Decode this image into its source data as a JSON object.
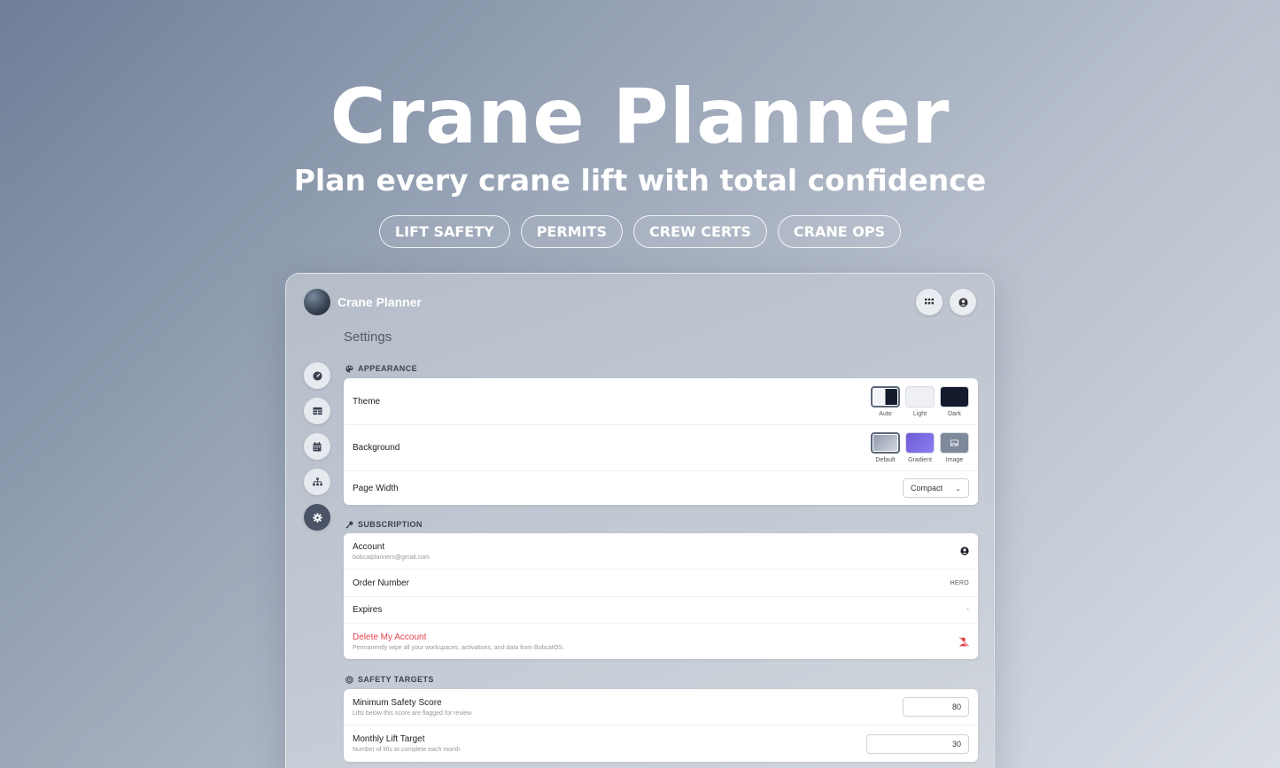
{
  "hero": {
    "title": "Crane Planner",
    "subtitle": "Plan every crane lift with total confidence",
    "tags": [
      "LIFT SAFETY",
      "PERMITS",
      "CREW CERTS",
      "CRANE OPS"
    ]
  },
  "window": {
    "app_name": "Crane Planner",
    "header_icons": [
      "grid-icon",
      "user-circle-icon"
    ],
    "settings_title": "Settings",
    "nav": [
      {
        "icon": "dashboard-icon",
        "active": false
      },
      {
        "icon": "table-icon",
        "active": false
      },
      {
        "icon": "calendar-icon",
        "active": false
      },
      {
        "icon": "org-chart-icon",
        "active": false
      },
      {
        "icon": "gear-icon",
        "active": true
      }
    ]
  },
  "appearance": {
    "section": "APPEARANCE",
    "theme_label": "Theme",
    "theme_options": [
      "Auto",
      "Light",
      "Dark"
    ],
    "theme_selected": "Auto",
    "background_label": "Background",
    "background_options": [
      "Default",
      "Gradient",
      "Image"
    ],
    "background_selected": "Default",
    "page_width_label": "Page Width",
    "page_width_value": "Compact"
  },
  "subscription": {
    "section": "SUBSCRIPTION",
    "account_label": "Account",
    "account_email": "bobcatplanners@gmail.com",
    "order_label": "Order Number",
    "order_value": "HERO",
    "expires_label": "Expires",
    "expires_value": "-",
    "delete_label": "Delete My Account",
    "delete_desc": "Permanently wipe all your workspaces, activations, and data from BobcatOS."
  },
  "safety": {
    "section": "SAFETY TARGETS",
    "min_score_label": "Minimum Safety Score",
    "min_score_desc": "Lifts below this score are flagged for review",
    "min_score_value": "80",
    "monthly_label": "Monthly Lift Target",
    "monthly_desc": "Number of lifts to complete each month",
    "monthly_value": "30"
  },
  "colors": {
    "accent": "#4a5466",
    "danger": "#e0424c",
    "dark_swatch": "#141b2d",
    "gradient_swatch_start": "#6f5bd6",
    "gradient_swatch_end": "#8a7ff0"
  }
}
